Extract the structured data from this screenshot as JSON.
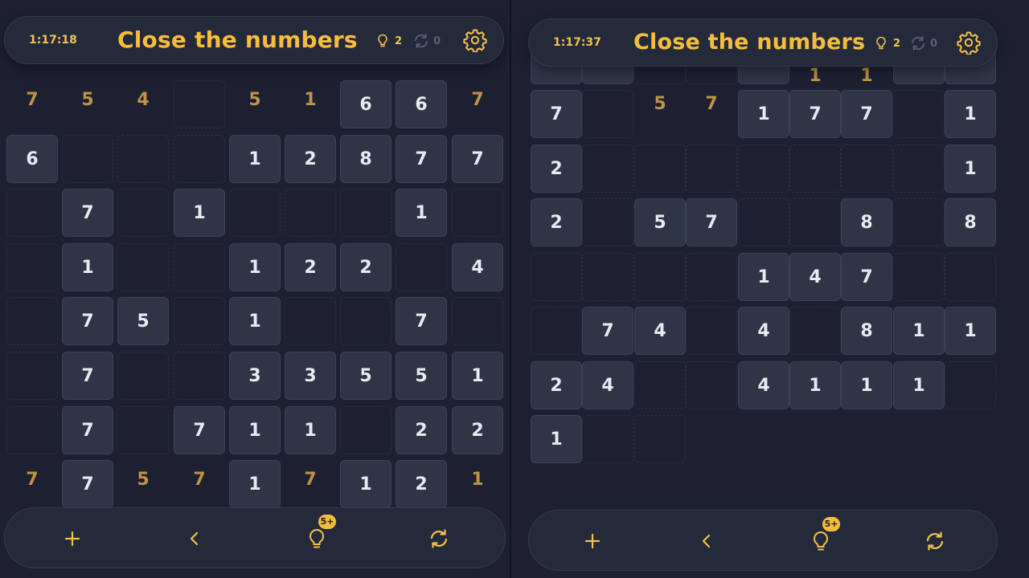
{
  "colors": {
    "accent": "#f6bd3c",
    "tile": "#2f3447",
    "background": "#1d2030",
    "used_number": "#bf9347"
  },
  "left": {
    "header": {
      "timer": "1:17:18",
      "title": "Close the numbers",
      "hints": "2",
      "refreshes": "0",
      "icons": [
        "bulb-icon",
        "refresh-icon",
        "gear-icon"
      ]
    },
    "rows": [
      [
        {
          "v": "7",
          "s": "used"
        },
        {
          "v": "5",
          "s": "used"
        },
        {
          "v": "4",
          "s": "used"
        },
        {
          "v": "",
          "s": "hole"
        },
        {
          "v": "5",
          "s": "used"
        },
        {
          "v": "1",
          "s": "used"
        },
        {
          "v": "6",
          "s": "tile"
        },
        {
          "v": "6",
          "s": "tile"
        },
        {
          "v": "7",
          "s": "used"
        }
      ],
      [
        {
          "v": "6",
          "s": "tile"
        },
        {
          "v": "",
          "s": "hole"
        },
        {
          "v": "",
          "s": "hole"
        },
        {
          "v": "",
          "s": "hole"
        },
        {
          "v": "1",
          "s": "tile"
        },
        {
          "v": "2",
          "s": "tile"
        },
        {
          "v": "8",
          "s": "tile"
        },
        {
          "v": "7",
          "s": "tile"
        },
        {
          "v": "7",
          "s": "tile"
        }
      ],
      [
        {
          "v": "",
          "s": "hole"
        },
        {
          "v": "7",
          "s": "tile"
        },
        {
          "v": "",
          "s": "hole"
        },
        {
          "v": "1",
          "s": "tile"
        },
        {
          "v": "",
          "s": "hole"
        },
        {
          "v": "",
          "s": "hole"
        },
        {
          "v": "",
          "s": "hole"
        },
        {
          "v": "1",
          "s": "tile"
        },
        {
          "v": "",
          "s": "hole"
        }
      ],
      [
        {
          "v": "",
          "s": "hole"
        },
        {
          "v": "1",
          "s": "tile"
        },
        {
          "v": "",
          "s": "hole"
        },
        {
          "v": "",
          "s": "hole"
        },
        {
          "v": "1",
          "s": "tile"
        },
        {
          "v": "2",
          "s": "tile"
        },
        {
          "v": "2",
          "s": "tile"
        },
        {
          "v": "",
          "s": "hole"
        },
        {
          "v": "4",
          "s": "tile"
        }
      ],
      [
        {
          "v": "",
          "s": "hole"
        },
        {
          "v": "7",
          "s": "tile"
        },
        {
          "v": "5",
          "s": "tile"
        },
        {
          "v": "",
          "s": "hole"
        },
        {
          "v": "1",
          "s": "tile"
        },
        {
          "v": "",
          "s": "hole"
        },
        {
          "v": "",
          "s": "hole"
        },
        {
          "v": "7",
          "s": "tile"
        },
        {
          "v": "",
          "s": "hole"
        }
      ],
      [
        {
          "v": "",
          "s": "hole"
        },
        {
          "v": "7",
          "s": "tile"
        },
        {
          "v": "",
          "s": "hole"
        },
        {
          "v": "",
          "s": "hole"
        },
        {
          "v": "3",
          "s": "tile"
        },
        {
          "v": "3",
          "s": "tile"
        },
        {
          "v": "5",
          "s": "tile"
        },
        {
          "v": "5",
          "s": "tile"
        },
        {
          "v": "1",
          "s": "tile"
        }
      ],
      [
        {
          "v": "",
          "s": "hole"
        },
        {
          "v": "7",
          "s": "tile"
        },
        {
          "v": "",
          "s": "hole"
        },
        {
          "v": "7",
          "s": "tile"
        },
        {
          "v": "1",
          "s": "tile"
        },
        {
          "v": "1",
          "s": "tile"
        },
        {
          "v": "",
          "s": "hole"
        },
        {
          "v": "2",
          "s": "tile"
        },
        {
          "v": "2",
          "s": "tile"
        }
      ],
      [
        {
          "v": "7",
          "s": "used"
        },
        {
          "v": "7",
          "s": "tile"
        },
        {
          "v": "5",
          "s": "used"
        },
        {
          "v": "7",
          "s": "used"
        },
        {
          "v": "1",
          "s": "tile"
        },
        {
          "v": "7",
          "s": "used"
        },
        {
          "v": "1",
          "s": "tile"
        },
        {
          "v": "2",
          "s": "tile"
        },
        {
          "v": "1",
          "s": "used"
        }
      ]
    ],
    "bottom": {
      "hint_badge": "5+",
      "icons": [
        "plus-icon",
        "back-icon",
        "bulb-icon",
        "refresh-icon"
      ]
    }
  },
  "right": {
    "header": {
      "timer": "1:17:37",
      "title": "Close the numbers",
      "hints": "2",
      "refreshes": "0",
      "icons": [
        "bulb-icon",
        "refresh-icon",
        "gear-icon"
      ]
    },
    "top_partial": [
      {
        "v": "",
        "s": "tile"
      },
      {
        "v": "",
        "s": "tile"
      },
      {
        "v": "",
        "s": "hole"
      },
      {
        "v": "",
        "s": "hole"
      },
      {
        "v": "",
        "s": "tile"
      },
      {
        "v": "1",
        "s": "used"
      },
      {
        "v": "1",
        "s": "used"
      },
      {
        "v": "",
        "s": "tile"
      },
      {
        "v": "",
        "s": "tile"
      }
    ],
    "rows": [
      [
        {
          "v": "7",
          "s": "tile"
        },
        {
          "v": "",
          "s": "hole"
        },
        {
          "v": "5",
          "s": "used"
        },
        {
          "v": "7",
          "s": "used"
        },
        {
          "v": "1",
          "s": "tile"
        },
        {
          "v": "7",
          "s": "tile"
        },
        {
          "v": "7",
          "s": "tile"
        },
        {
          "v": "",
          "s": "hole"
        },
        {
          "v": "1",
          "s": "tile"
        }
      ],
      [
        {
          "v": "2",
          "s": "tile"
        },
        {
          "v": "",
          "s": "hole"
        },
        {
          "v": "",
          "s": "hole"
        },
        {
          "v": "",
          "s": "hole"
        },
        {
          "v": "",
          "s": "hole"
        },
        {
          "v": "",
          "s": "hole"
        },
        {
          "v": "",
          "s": "hole"
        },
        {
          "v": "",
          "s": "hole"
        },
        {
          "v": "1",
          "s": "tile"
        }
      ],
      [
        {
          "v": "2",
          "s": "tile"
        },
        {
          "v": "",
          "s": "hole"
        },
        {
          "v": "5",
          "s": "tile"
        },
        {
          "v": "7",
          "s": "tile"
        },
        {
          "v": "",
          "s": "hole"
        },
        {
          "v": "",
          "s": "hole"
        },
        {
          "v": "8",
          "s": "tile"
        },
        {
          "v": "",
          "s": "hole"
        },
        {
          "v": "8",
          "s": "tile"
        }
      ],
      [
        {
          "v": "",
          "s": "hole"
        },
        {
          "v": "",
          "s": "hole"
        },
        {
          "v": "",
          "s": "hole"
        },
        {
          "v": "",
          "s": "hole"
        },
        {
          "v": "1",
          "s": "tile"
        },
        {
          "v": "4",
          "s": "tile"
        },
        {
          "v": "7",
          "s": "tile"
        },
        {
          "v": "",
          "s": "hole"
        },
        {
          "v": "",
          "s": "hole"
        }
      ],
      [
        {
          "v": "",
          "s": "hole"
        },
        {
          "v": "7",
          "s": "tile"
        },
        {
          "v": "4",
          "s": "tile"
        },
        {
          "v": "",
          "s": "hole"
        },
        {
          "v": "4",
          "s": "tile"
        },
        {
          "v": "",
          "s": "hole"
        },
        {
          "v": "8",
          "s": "tile"
        },
        {
          "v": "1",
          "s": "tile"
        },
        {
          "v": "1",
          "s": "tile"
        }
      ],
      [
        {
          "v": "2",
          "s": "tile"
        },
        {
          "v": "4",
          "s": "tile"
        },
        {
          "v": "",
          "s": "hole"
        },
        {
          "v": "",
          "s": "hole"
        },
        {
          "v": "4",
          "s": "tile"
        },
        {
          "v": "1",
          "s": "tile"
        },
        {
          "v": "1",
          "s": "tile"
        },
        {
          "v": "1",
          "s": "tile"
        },
        {
          "v": "",
          "s": "hole"
        }
      ],
      [
        {
          "v": "1",
          "s": "tile"
        },
        {
          "v": "",
          "s": "hole"
        },
        {
          "v": "",
          "s": "hole"
        }
      ]
    ],
    "bottom": {
      "hint_badge": "5+",
      "icons": [
        "plus-icon",
        "back-icon",
        "bulb-icon",
        "refresh-icon"
      ]
    }
  }
}
